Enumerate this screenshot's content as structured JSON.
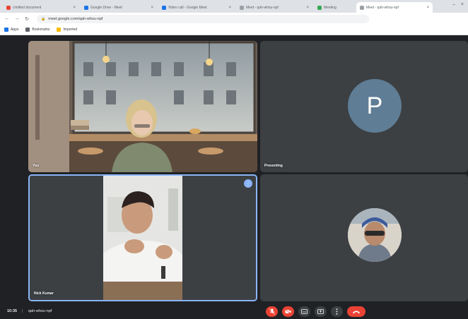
{
  "browser": {
    "tabs": [
      {
        "label": "Untitled document",
        "active": false,
        "favicon_color": "#ea4335"
      },
      {
        "label": "Google Drive - Meet",
        "active": false,
        "favicon_color": "#1a73e8"
      },
      {
        "label": "Video call - Google Meet",
        "active": false,
        "favicon_color": "#1a73e8"
      },
      {
        "label": "Meet - qah-whsu-npf",
        "active": false,
        "favicon_color": "#9aa0a6"
      },
      {
        "label": "Meeting",
        "active": false,
        "favicon_color": "#34a853"
      },
      {
        "label": "Meet - qah-whsu-npf",
        "active": true,
        "favicon_color": "#9aa0a6"
      }
    ],
    "url": "meet.google.com/qah-whsu-npf",
    "bookmarks": [
      {
        "label": "Apps",
        "color": "#1a73e8"
      },
      {
        "label": "Bookmarks",
        "color": "#5f6368"
      },
      {
        "label": "Imported",
        "color": "#fbbc04"
      }
    ]
  },
  "meet": {
    "participants": [
      {
        "name": "You",
        "type": "video"
      },
      {
        "name": "Presenting",
        "type": "avatar-letter",
        "initial": "P",
        "avatar_color": "#5f7d95"
      },
      {
        "name": "Nick Kumar",
        "type": "video",
        "speaking": true
      },
      {
        "name": "",
        "type": "avatar-photo"
      }
    ],
    "time": "10:35",
    "separator": "|",
    "meeting_code": "qah-whsu-npf"
  },
  "colors": {
    "background": "#202124",
    "tile": "#3c4043",
    "accent": "#8ab4f8",
    "danger": "#ea4335"
  },
  "icons": {
    "mic_off": "mic-off-icon",
    "camera_off": "videocam-off-icon",
    "captions": "captions-icon",
    "present": "present-icon",
    "more": "more-icon",
    "end_call": "call-end-icon"
  }
}
